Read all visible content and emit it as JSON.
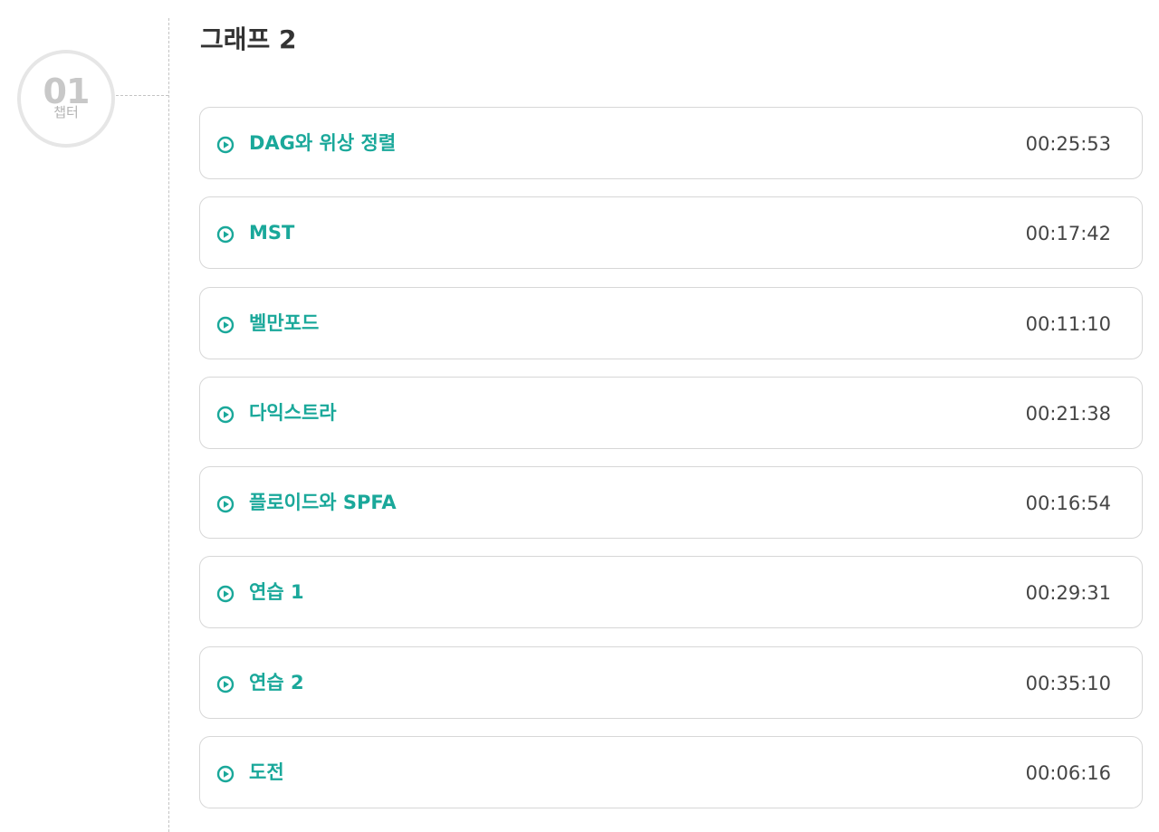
{
  "chapter": {
    "number": "01",
    "label": "챕터"
  },
  "section": {
    "title": "그래프 2"
  },
  "colors": {
    "accent": "#1aa89a",
    "text": "#333333",
    "border": "#d7d7d7",
    "badge": "#c8c8c8"
  },
  "lessons": [
    {
      "title": "DAG와 위상 정렬",
      "duration": "00:25:53",
      "icon": "play-circle-icon"
    },
    {
      "title": "MST",
      "duration": "00:17:42",
      "icon": "play-circle-icon"
    },
    {
      "title": "벨만포드",
      "duration": "00:11:10",
      "icon": "play-circle-icon"
    },
    {
      "title": "다익스트라",
      "duration": "00:21:38",
      "icon": "play-circle-icon"
    },
    {
      "title": "플로이드와 SPFA",
      "duration": "00:16:54",
      "icon": "play-circle-icon"
    },
    {
      "title": "연습 1",
      "duration": "00:29:31",
      "icon": "play-circle-icon"
    },
    {
      "title": "연습 2",
      "duration": "00:35:10",
      "icon": "play-circle-icon"
    },
    {
      "title": "도전",
      "duration": "00:06:16",
      "icon": "play-circle-icon"
    }
  ]
}
